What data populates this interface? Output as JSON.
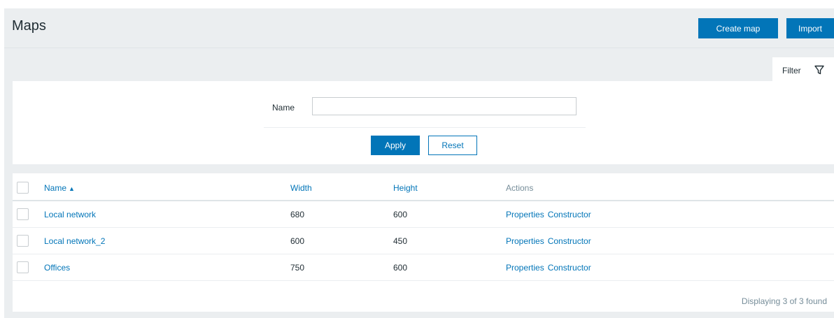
{
  "header": {
    "title": "Maps",
    "create_label": "Create map",
    "import_label": "Import"
  },
  "filter": {
    "tab_label": "Filter",
    "tab_icon": "funnel-icon",
    "name_label": "Name",
    "name_value": "",
    "name_placeholder": "",
    "apply_label": "Apply",
    "reset_label": "Reset"
  },
  "table": {
    "columns": {
      "name": "Name",
      "name_sort_indicator": "▲",
      "width": "Width",
      "height": "Height",
      "actions": "Actions"
    },
    "rows": [
      {
        "name": "Local network",
        "width": "680",
        "height": "600",
        "properties": "Properties",
        "constructor": "Constructor"
      },
      {
        "name": "Local network_2",
        "width": "600",
        "height": "450",
        "properties": "Properties",
        "constructor": "Constructor"
      },
      {
        "name": "Offices",
        "width": "750",
        "height": "600",
        "properties": "Properties",
        "constructor": "Constructor"
      }
    ],
    "footer": "Displaying 3 of 3 found"
  },
  "colors": {
    "accent": "#0275b8",
    "background": "#ebeef0",
    "muted_text": "#768d99"
  }
}
